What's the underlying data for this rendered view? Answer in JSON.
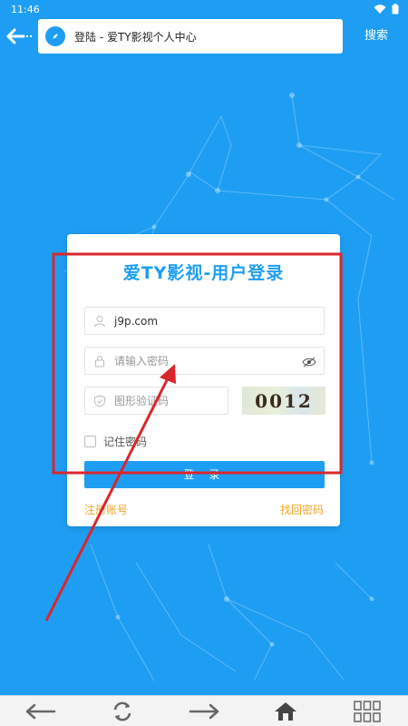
{
  "status_bar": {
    "time": "11:46"
  },
  "top_bar": {
    "url_title": "登陆 - 爱TY影视个人中心",
    "search_label": "搜索"
  },
  "login_card": {
    "title": "爱TY影视-用户登录",
    "username_value": "j9p.com",
    "password_placeholder": "请输入密码",
    "captcha_placeholder": "图形验证码",
    "captcha_text": "0012",
    "remember_label": "记住密码",
    "login_button": "登 录",
    "register_link": "注册账号",
    "forgot_link": "找回密码"
  },
  "bottom_nav": {
    "icons": [
      "back-arrow-icon",
      "refresh-icon",
      "forward-arrow-icon",
      "home-icon",
      "grid-menu-icon"
    ]
  },
  "colors": {
    "primary": "#1e9ef3",
    "link": "#f5a623",
    "annotation": "#d9262b"
  }
}
